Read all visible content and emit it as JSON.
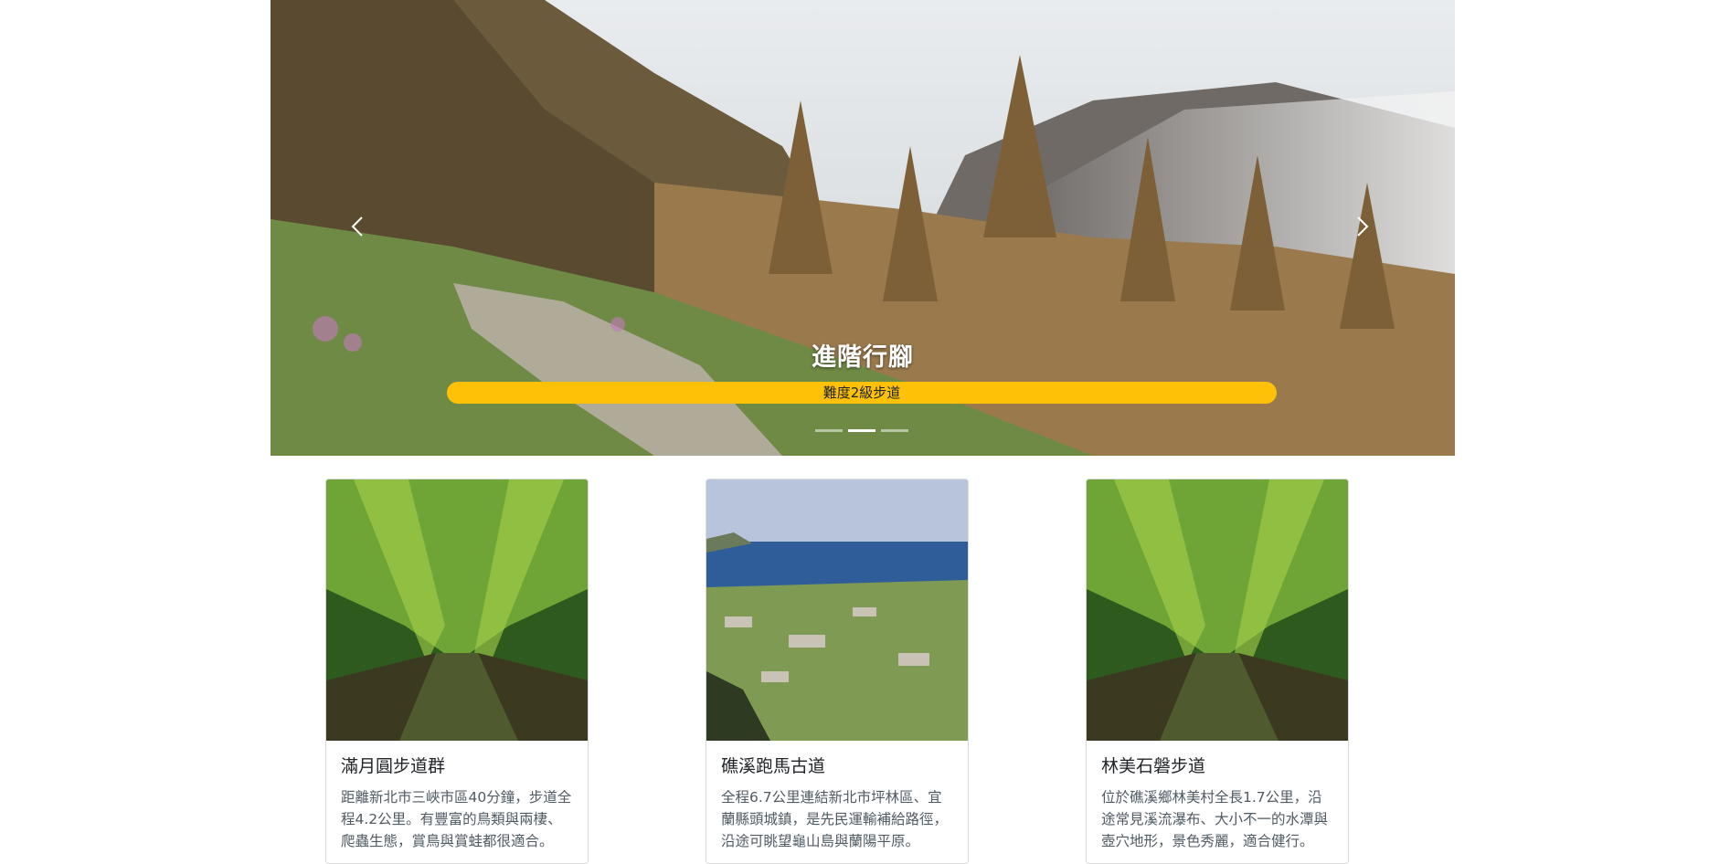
{
  "carousel": {
    "caption_title": "進階行腳",
    "caption_badge": "難度2級步道",
    "indicator_count": 3,
    "active_indicator": 2
  },
  "cards": [
    {
      "title": "滿月圓步道群",
      "text": "距離新北市三峽市區40分鐘，步道全程4.2公里。有豐富的鳥類與兩棲、爬蟲生態，賞鳥與賞蛙都很適合。"
    },
    {
      "title": "礁溪跑馬古道",
      "text": "全程6.7公里連結新北市坪林區、宜蘭縣頭城鎮，是先民運輸補給路徑，沿途可眺望龜山島與蘭陽平原。"
    },
    {
      "title": "林美石磐步道",
      "text": "位於礁溪鄉林美村全長1.7公里，沿途常見溪流瀑布、大小不一的水潭與壺穴地形，景色秀麗，適合健行。"
    }
  ],
  "colors": {
    "badge": "#ffc107",
    "card_border": "rgba(0,0,0,0.15)"
  }
}
